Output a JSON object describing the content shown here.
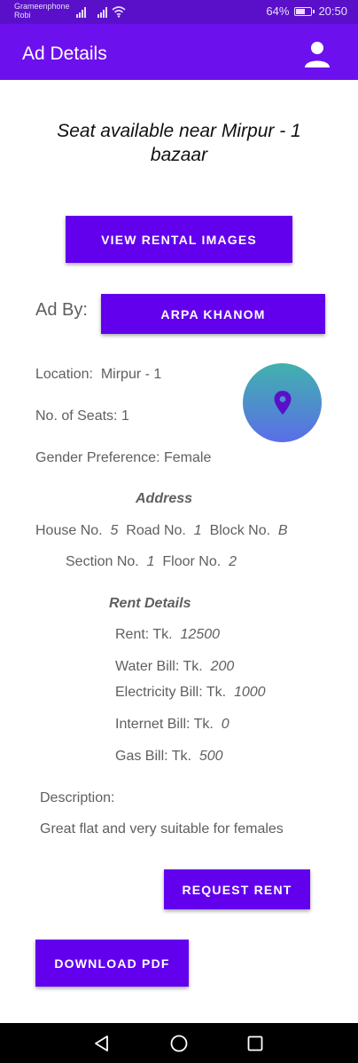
{
  "status_bar": {
    "carrier_1": "Grameenphone",
    "carrier_2": "Robi",
    "battery_percent": "64%",
    "battery_level": 0.64,
    "time": "20:50"
  },
  "app_bar": {
    "title": "Ad Details",
    "profile_icon": "person-icon"
  },
  "ad": {
    "title": "Seat available near Mirpur - 1 bazaar",
    "view_images_label": "VIEW RENTAL IMAGES",
    "ad_by_label": "Ad By:",
    "author_name": "ARPA KHANOM",
    "location_label": "Location:",
    "location_value": "Mirpur - 1",
    "seats_label": "No. of Seats:",
    "seats_value": "1",
    "gender_label": "Gender Preference:",
    "gender_value": "Female",
    "map_icon": "map-pin-icon"
  },
  "address": {
    "heading": "Address",
    "house_label": "House No.",
    "house_value": "5",
    "road_label": "Road No.",
    "road_value": "1",
    "block_label": "Block No.",
    "block_value": "B",
    "section_label": "Section No.",
    "section_value": "1",
    "floor_label": "Floor No.",
    "floor_value": "2"
  },
  "rent": {
    "heading": "Rent Details",
    "rent_label": "Rent: Tk.",
    "rent_value": "12500",
    "water_label": "Water Bill: Tk.",
    "water_value": "200",
    "electricity_label": "Electricity Bill: Tk.",
    "electricity_value": "1000",
    "internet_label": "Internet Bill: Tk.",
    "internet_value": "0",
    "gas_label": "Gas Bill: Tk.",
    "gas_value": "500"
  },
  "description": {
    "label": "Description:",
    "text": "Great flat and very suitable for females"
  },
  "actions": {
    "request_label": "REQUEST RENT",
    "download_label": "DOWNLOAD PDF"
  },
  "nav": {
    "back_icon": "back-triangle-icon",
    "home_icon": "home-circle-icon",
    "recents_icon": "recents-square-icon"
  },
  "colors": {
    "primary": "#6200ee",
    "app_bar": "#6d10ee",
    "status_bar": "#5a10c9",
    "fab_gradient_top": "#41b2ac",
    "fab_gradient_bottom": "#5a6ee8"
  }
}
